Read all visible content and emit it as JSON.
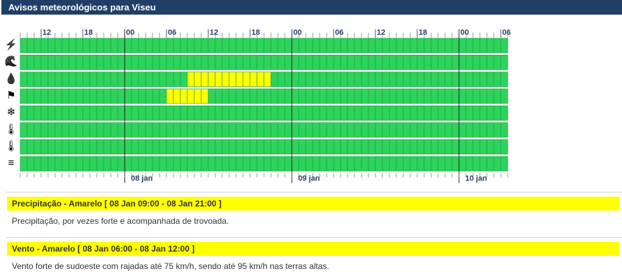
{
  "header": {
    "title": "Avisos meteorológicos para Viseu"
  },
  "timeline": {
    "tick_labels": [
      "12",
      "18",
      "00",
      "06",
      "12",
      "18",
      "00",
      "06",
      "12",
      "18",
      "00",
      "06"
    ],
    "day_labels": [
      "08 jan",
      "09 jan",
      "10 jan"
    ]
  },
  "rows": [
    {
      "icon": "lightning-icon",
      "glyph": "⚡"
    },
    {
      "icon": "coastal-wave-icon",
      "glyph": "🌊"
    },
    {
      "icon": "rain-drops-icon",
      "glyph": "💧"
    },
    {
      "icon": "windsock-icon",
      "glyph": "⚑"
    },
    {
      "icon": "snowflake-icon",
      "glyph": "❄"
    },
    {
      "icon": "thermometer-cold-icon",
      "glyph": "🌡"
    },
    {
      "icon": "thermometer-hot-icon",
      "glyph": "🌡"
    },
    {
      "icon": "fog-icon",
      "glyph": "≡"
    }
  ],
  "warning_levels": {
    "green": "#2ed35c",
    "yellow": "#ffff00"
  },
  "warnings": [
    {
      "heading": "Precipitação - Amarelo [ 08 Jan 09:00 - 08 Jan 21:00 ]",
      "description": "Precipitação, por vezes forte e acompanhada de trovoada."
    },
    {
      "heading": "Vento - Amarelo [ 08 Jan 06:00 - 08 Jan 12:00 ]",
      "description": "Vento forte de sudoeste com rajadas até 75 km/h, sendo até 95 km/h nas terras altas."
    }
  ]
}
